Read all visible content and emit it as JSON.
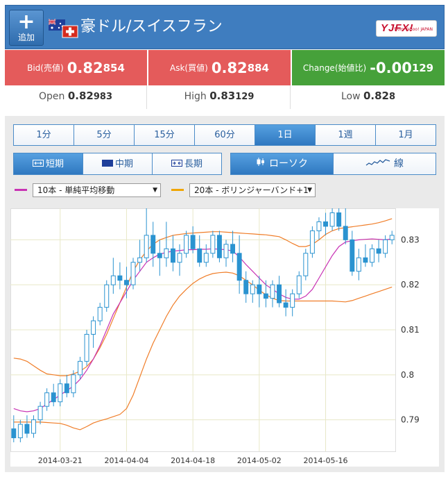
{
  "header": {
    "add_label": "追加",
    "add_symbol": "+",
    "title": "豪ドル/スイスフラン",
    "brand": "YJFX!",
    "brand_sub": "from Yahoo! JAPAN"
  },
  "quotes": {
    "bid": {
      "label": "Bid(売値)",
      "big": "0.82",
      "small": "854"
    },
    "ask": {
      "label": "Ask(買値)",
      "big": "0.82",
      "small": "884"
    },
    "change": {
      "label": "Change(始値比)",
      "big": "-0.00",
      "small": "129"
    }
  },
  "ohl": {
    "open": {
      "label": "Open",
      "big": "0.82",
      "small": "983"
    },
    "high": {
      "label": "High",
      "big": "0.83",
      "small": "129"
    },
    "low": {
      "label": "Low",
      "big": "0.82",
      "small": "8"
    }
  },
  "timeframes": [
    "1分",
    "5分",
    "15分",
    "60分",
    "1日",
    "1週",
    "1月"
  ],
  "active_timeframe": "1日",
  "periods": [
    {
      "label": "短期",
      "icon": "expand-arrows-icon"
    },
    {
      "label": "中期",
      "icon": "square-icon"
    },
    {
      "label": "長期",
      "icon": "compress-arrows-icon"
    }
  ],
  "active_period": "短期",
  "chart_types": [
    {
      "label": "ローソク",
      "icon": "candlestick-icon"
    },
    {
      "label": "線",
      "icon": "line-chart-icon"
    }
  ],
  "active_chart_type": "ローソク",
  "indicators": {
    "ma": {
      "label": "10本 - 単純平均移動",
      "color": "#c832b4"
    },
    "bb": {
      "label": "20本 - ボリンジャーバンド+1",
      "color": "#f0a500"
    }
  },
  "colors": {
    "up": "#ffffff",
    "down": "#2a93d0",
    "candle_border": "#2a93d0",
    "ma_line": "#c832b4",
    "bb_line": "#f07d28"
  },
  "chart_data": {
    "type": "candlestick",
    "x_ticks": [
      "2014-03-21",
      "2014-04-04",
      "2014-04-18",
      "2014-05-02",
      "2014-05-16"
    ],
    "y_ticks": [
      "0.79",
      "0.8",
      "0.81",
      "0.82",
      "0.83"
    ],
    "ylim": [
      0.783,
      0.837
    ],
    "candles": [
      [
        0.788,
        0.791,
        0.785,
        0.786
      ],
      [
        0.786,
        0.79,
        0.785,
        0.789
      ],
      [
        0.789,
        0.791,
        0.786,
        0.787
      ],
      [
        0.787,
        0.791,
        0.786,
        0.79
      ],
      [
        0.79,
        0.794,
        0.789,
        0.793
      ],
      [
        0.793,
        0.797,
        0.792,
        0.796
      ],
      [
        0.796,
        0.798,
        0.793,
        0.794
      ],
      [
        0.794,
        0.799,
        0.793,
        0.798
      ],
      [
        0.798,
        0.8,
        0.795,
        0.796
      ],
      [
        0.796,
        0.801,
        0.795,
        0.8
      ],
      [
        0.8,
        0.804,
        0.799,
        0.803
      ],
      [
        0.803,
        0.81,
        0.802,
        0.809
      ],
      [
        0.809,
        0.813,
        0.806,
        0.812
      ],
      [
        0.812,
        0.816,
        0.811,
        0.815
      ],
      [
        0.815,
        0.821,
        0.814,
        0.82
      ],
      [
        0.82,
        0.826,
        0.818,
        0.822
      ],
      [
        0.822,
        0.825,
        0.819,
        0.821
      ],
      [
        0.821,
        0.824,
        0.817,
        0.82
      ],
      [
        0.82,
        0.826,
        0.819,
        0.825
      ],
      [
        0.825,
        0.83,
        0.823,
        0.826
      ],
      [
        0.826,
        0.837,
        0.825,
        0.831
      ],
      [
        0.831,
        0.834,
        0.824,
        0.827
      ],
      [
        0.827,
        0.83,
        0.822,
        0.826
      ],
      [
        0.826,
        0.834,
        0.824,
        0.828
      ],
      [
        0.828,
        0.831,
        0.823,
        0.825
      ],
      [
        0.825,
        0.829,
        0.822,
        0.827
      ],
      [
        0.827,
        0.832,
        0.826,
        0.831
      ],
      [
        0.831,
        0.833,
        0.827,
        0.828
      ],
      [
        0.828,
        0.831,
        0.824,
        0.825
      ],
      [
        0.825,
        0.829,
        0.824,
        0.827
      ],
      [
        0.827,
        0.832,
        0.826,
        0.831
      ],
      [
        0.831,
        0.832,
        0.825,
        0.826
      ],
      [
        0.826,
        0.83,
        0.824,
        0.829
      ],
      [
        0.829,
        0.832,
        0.825,
        0.827
      ],
      [
        0.827,
        0.831,
        0.818,
        0.821
      ],
      [
        0.821,
        0.823,
        0.816,
        0.818
      ],
      [
        0.818,
        0.821,
        0.816,
        0.82
      ],
      [
        0.82,
        0.822,
        0.815,
        0.818
      ],
      [
        0.818,
        0.821,
        0.815,
        0.817
      ],
      [
        0.817,
        0.821,
        0.815,
        0.82
      ],
      [
        0.82,
        0.822,
        0.815,
        0.816
      ],
      [
        0.816,
        0.819,
        0.813,
        0.815
      ],
      [
        0.815,
        0.819,
        0.813,
        0.818
      ],
      [
        0.818,
        0.823,
        0.817,
        0.822
      ],
      [
        0.822,
        0.828,
        0.821,
        0.827
      ],
      [
        0.827,
        0.833,
        0.826,
        0.832
      ],
      [
        0.832,
        0.835,
        0.83,
        0.834
      ],
      [
        0.834,
        0.836,
        0.831,
        0.833
      ],
      [
        0.833,
        0.838,
        0.832,
        0.836
      ],
      [
        0.836,
        0.838,
        0.832,
        0.833
      ],
      [
        0.833,
        0.837,
        0.829,
        0.83
      ],
      [
        0.83,
        0.832,
        0.822,
        0.823
      ],
      [
        0.823,
        0.828,
        0.821,
        0.826
      ],
      [
        0.826,
        0.829,
        0.824,
        0.825
      ],
      [
        0.825,
        0.829,
        0.824,
        0.828
      ],
      [
        0.828,
        0.83,
        0.825,
        0.827
      ],
      [
        0.827,
        0.831,
        0.826,
        0.83
      ],
      [
        0.83,
        0.832,
        0.829,
        0.831
      ]
    ],
    "ma": [
      0.7925,
      0.792,
      0.7918,
      0.792,
      0.7925,
      0.7935,
      0.7945,
      0.7955,
      0.7965,
      0.7975,
      0.799,
      0.801,
      0.8035,
      0.8065,
      0.81,
      0.8135,
      0.816,
      0.8185,
      0.821,
      0.823,
      0.825,
      0.826,
      0.8268,
      0.8272,
      0.8275,
      0.8276,
      0.8278,
      0.8278,
      0.8279,
      0.8279,
      0.828,
      0.8279,
      0.8278,
      0.8275,
      0.8262,
      0.8245,
      0.823,
      0.8215,
      0.82,
      0.819,
      0.818,
      0.8172,
      0.8168,
      0.8168,
      0.8175,
      0.819,
      0.8215,
      0.824,
      0.8265,
      0.8285,
      0.8295,
      0.8298,
      0.83,
      0.8301,
      0.8302,
      0.8301,
      0.83,
      0.8302
    ],
    "bb_upper": [
      0.8037,
      0.8035,
      0.803,
      0.802,
      0.801,
      0.8002,
      0.8,
      0.7998,
      0.7998,
      0.8002,
      0.8008,
      0.8018,
      0.8035,
      0.806,
      0.809,
      0.8125,
      0.816,
      0.8195,
      0.823,
      0.8255,
      0.8275,
      0.829,
      0.83,
      0.8305,
      0.831,
      0.8312,
      0.8314,
      0.8315,
      0.8316,
      0.8317,
      0.8318,
      0.8318,
      0.8317,
      0.8316,
      0.8315,
      0.8314,
      0.8313,
      0.8312,
      0.8311,
      0.8309,
      0.8307,
      0.83,
      0.8292,
      0.8285,
      0.8285,
      0.829,
      0.83,
      0.8312,
      0.832,
      0.8325,
      0.8327,
      0.8329,
      0.8331,
      0.8333,
      0.8335,
      0.8338,
      0.8342,
      0.8347
    ],
    "bb_lower": [
      0.7895,
      0.7895,
      0.7895,
      0.7895,
      0.7895,
      0.7894,
      0.7893,
      0.7892,
      0.7888,
      0.7882,
      0.7878,
      0.7885,
      0.7893,
      0.7898,
      0.7902,
      0.7907,
      0.7912,
      0.7925,
      0.7955,
      0.7995,
      0.8035,
      0.807,
      0.81,
      0.813,
      0.8155,
      0.8175,
      0.819,
      0.8203,
      0.8213,
      0.822,
      0.8225,
      0.8227,
      0.8228,
      0.8226,
      0.822,
      0.821,
      0.82,
      0.8188,
      0.8178,
      0.817,
      0.8165,
      0.8164,
      0.8164,
      0.8164,
      0.8164,
      0.8164,
      0.8164,
      0.8164,
      0.8164,
      0.8163,
      0.8162,
      0.8165,
      0.817,
      0.8175,
      0.818,
      0.8185,
      0.819,
      0.8195
    ]
  }
}
